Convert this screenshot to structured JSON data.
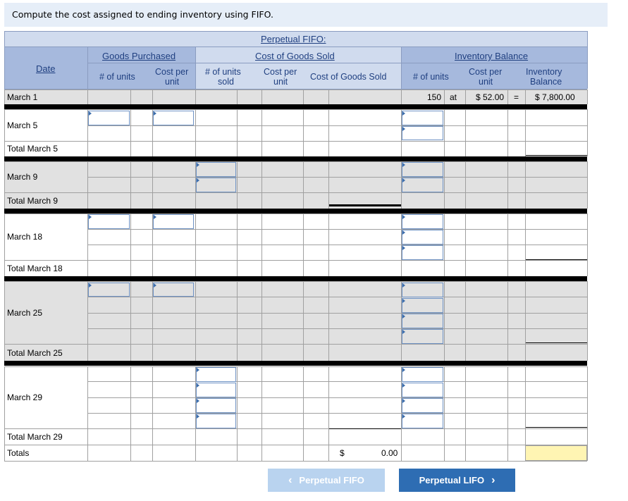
{
  "instruction": "Compute the cost assigned to ending inventory using FIFO.",
  "header": {
    "title": "Perpetual FIFO:",
    "groups": {
      "purchased": "Goods Purchased",
      "cogs": "Cost of Goods Sold",
      "balance": "Inventory Balance"
    },
    "date": "Date",
    "cols": {
      "p_units": "# of units",
      "p_cost_1": "Cost per",
      "p_cost_2": "unit",
      "s_units_1": "# of units",
      "s_units_2": "sold",
      "s_cost_1": "Cost per",
      "s_cost_2": "unit",
      "s_cogs": "Cost of Goods Sold",
      "b_units": "# of units",
      "b_cost_1": "Cost per",
      "b_cost_2": "unit",
      "b_bal_1": "Inventory",
      "b_bal_2": "Balance"
    }
  },
  "rows": {
    "march1": "March 1",
    "march5": "March 5",
    "total_march5": "Total March 5",
    "march9": "March 9",
    "total_march9": "Total March 9",
    "march18": "March 18",
    "total_march18": "Total March 18",
    "march25": "March 25",
    "total_march25": "Total March 25",
    "march29": "March 29",
    "total_march29": "Total March 29",
    "totals": "Totals"
  },
  "beginning": {
    "units": "150",
    "at": "at",
    "cost": "$ 52.00",
    "eq": "=",
    "balance": "$  7,800.00"
  },
  "totals": {
    "currency": "$",
    "value": "0.00"
  },
  "nav": {
    "prev": "Perpetual FIFO",
    "next": "Perpetual LIFO"
  },
  "colors": {
    "header": "#a6b9dd",
    "header_light": "#d0dbee",
    "shade": "#e1e1e1",
    "total_highlight": "#fff5b3",
    "next_button": "#2e6db3",
    "prev_button": "#b9d3ef"
  }
}
